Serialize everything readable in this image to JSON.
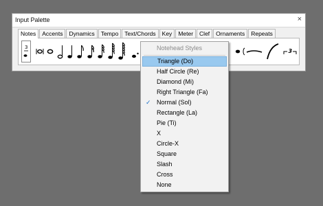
{
  "window": {
    "title": "Input Palette",
    "close_glyph": "×"
  },
  "tabs": [
    "Notes",
    "Accents",
    "Dynamics",
    "Tempo",
    "Text/Chords",
    "Key",
    "Meter",
    "Clef",
    "Ornaments",
    "Repeats"
  ],
  "active_tab": "Notes",
  "palette_icons": [
    "tuplet-duration-icon",
    "double-whole-note-icon",
    "whole-note-icon",
    "half-note-icon",
    "quarter-note-icon",
    "eighth-note-icon",
    "sixteenth-note-icon",
    "thirty-second-note-icon",
    "sixty-fourth-note-icon",
    "one-twenty-eighth-note-icon",
    "dotted-note-icon",
    "notehead-icon",
    "tie-icon",
    "slur-icon",
    "triplet-icon"
  ],
  "palette_symbols": {
    "tuplet_top": "3",
    "triplet_label": "3"
  },
  "menu": {
    "header": "Notehead Styles",
    "items": [
      {
        "label": "Triangle (Do)",
        "highlighted": true,
        "checked": false
      },
      {
        "label": "Half Circle (Re)",
        "highlighted": false,
        "checked": false
      },
      {
        "label": "Diamond (Mi)",
        "highlighted": false,
        "checked": false
      },
      {
        "label": "Right Triangle (Fa)",
        "highlighted": false,
        "checked": false
      },
      {
        "label": "Normal (Sol)",
        "highlighted": false,
        "checked": true
      },
      {
        "label": "Rectangle (La)",
        "highlighted": false,
        "checked": false
      },
      {
        "label": "Pie (Ti)",
        "highlighted": false,
        "checked": false
      },
      {
        "label": "X",
        "highlighted": false,
        "checked": false
      },
      {
        "label": "Circle-X",
        "highlighted": false,
        "checked": false
      },
      {
        "label": "Square",
        "highlighted": false,
        "checked": false
      },
      {
        "label": "Slash",
        "highlighted": false,
        "checked": false
      },
      {
        "label": "Cross",
        "highlighted": false,
        "checked": false
      },
      {
        "label": "None",
        "highlighted": false,
        "checked": false
      }
    ],
    "check_glyph": "✓"
  },
  "colors": {
    "background": "#6e6e6e",
    "highlight": "#99c9ef",
    "check": "#1e72c8"
  }
}
